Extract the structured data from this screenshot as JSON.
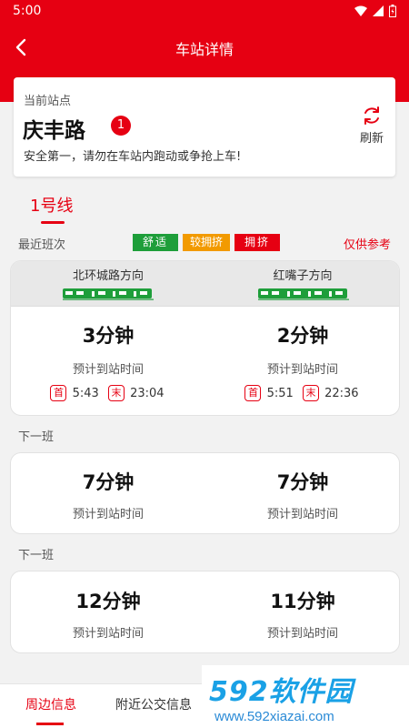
{
  "status": {
    "time": "5:00"
  },
  "appbar": {
    "title": "车站详情"
  },
  "station": {
    "current_label": "当前站点",
    "name": "庆丰路",
    "badge": "1",
    "tip": "安全第一，请勿在车站内跑动或争抢上车!",
    "refresh_label": "刷新"
  },
  "line": {
    "tab_label": "1号线"
  },
  "legend": {
    "label": "最近班次",
    "chips": [
      {
        "text": "舒适",
        "color": "#1e9e3a"
      },
      {
        "text": "较拥挤",
        "color": "#f29a00"
      },
      {
        "text": "拥挤",
        "color": "#e60012"
      }
    ],
    "reference": "仅供参考"
  },
  "directions": [
    {
      "name": "北环城路方向",
      "first_mark": "首",
      "first": "5:43",
      "last_mark": "末",
      "last": "23:04"
    },
    {
      "name": "红嘴子方向",
      "first_mark": "首",
      "first": "5:51",
      "last_mark": "末",
      "last": "22:36"
    }
  ],
  "trains": [
    {
      "label": "",
      "left": {
        "mins": "3分钟",
        "sub": "预计到站时间"
      },
      "right": {
        "mins": "2分钟",
        "sub": "预计到站时间"
      }
    },
    {
      "label": "下一班",
      "left": {
        "mins": "7分钟",
        "sub": "预计到站时间"
      },
      "right": {
        "mins": "7分钟",
        "sub": "预计到站时间"
      }
    },
    {
      "label": "下一班",
      "left": {
        "mins": "12分钟",
        "sub": "预计到站时间"
      },
      "right": {
        "mins": "11分钟",
        "sub": "预计到站时间"
      }
    }
  ],
  "tabs": [
    {
      "label": "周边信息",
      "active": true
    },
    {
      "label": "附近公交信息",
      "active": false
    }
  ],
  "watermark": {
    "big": "592软件园",
    "url": "www.592xiazai.com"
  },
  "colors": {
    "accent": "#e60012",
    "train": "#1e9e3a"
  },
  "icons": {
    "back": "back-arrow-icon",
    "refresh": "refresh-icon",
    "train": "train-icon",
    "wifi": "wifi-icon",
    "signal": "signal-icon",
    "battery": "battery-icon"
  }
}
